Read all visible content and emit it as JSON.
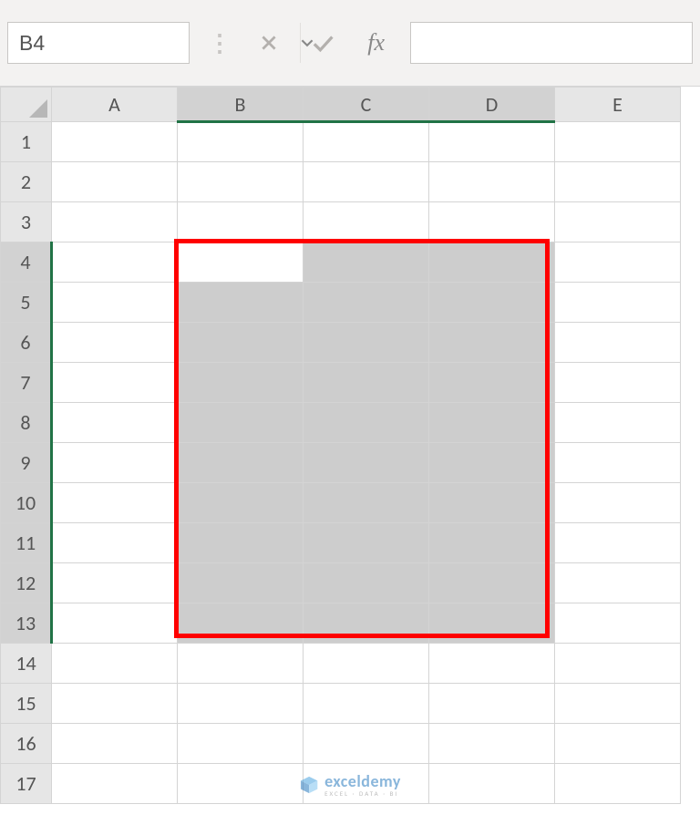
{
  "nameBox": {
    "value": "B4"
  },
  "formulaBar": {
    "fxLabel": "fx",
    "value": ""
  },
  "columns": [
    "A",
    "B",
    "C",
    "D",
    "E"
  ],
  "rows": [
    "1",
    "2",
    "3",
    "4",
    "5",
    "6",
    "7",
    "8",
    "9",
    "10",
    "11",
    "12",
    "13",
    "14",
    "15",
    "16",
    "17"
  ],
  "selection": {
    "activeCell": "B4",
    "rangeCols": [
      "B",
      "C",
      "D"
    ],
    "rangeRows": [
      "4",
      "5",
      "6",
      "7",
      "8",
      "9",
      "10",
      "11",
      "12",
      "13"
    ]
  },
  "annotation": {
    "highlightRange": "B4:D13"
  },
  "watermark": {
    "brand": "exceldemy",
    "tagline": "EXCEL · DATA · BI"
  },
  "colors": {
    "excelGreen": "#217346",
    "highlightRed": "#ff0000",
    "selFill": "#cdcdcd"
  }
}
